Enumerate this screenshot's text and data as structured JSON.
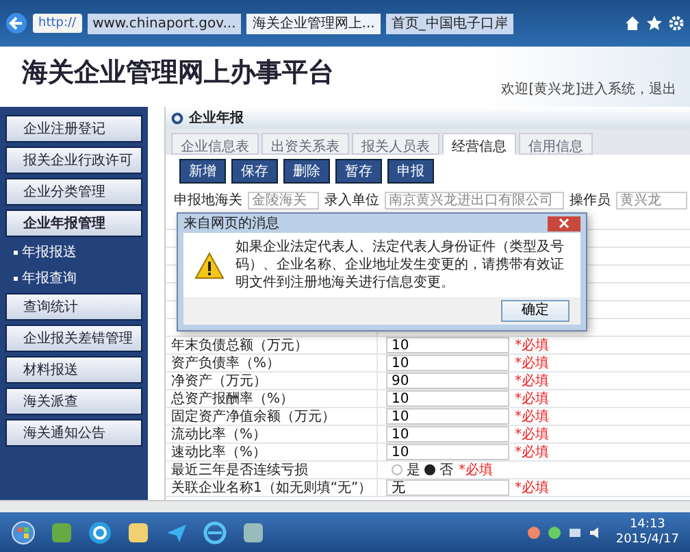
{
  "browser": {
    "address": "http://",
    "tabs": [
      {
        "label": "www.chinaport.gov...",
        "selected": false
      },
      {
        "label": "海关企业管理网上...",
        "selected": true
      },
      {
        "label": "首页_中国电子口岸",
        "selected": false
      }
    ]
  },
  "header": {
    "title": "海关企业管理网上办事平台",
    "welcome": "欢迎[黄兴龙]进入系统，退出"
  },
  "sidebar": {
    "items": [
      {
        "label": "企业注册登记",
        "expanded": false
      },
      {
        "label": "报关企业行政许可",
        "expanded": false
      },
      {
        "label": "企业分类管理",
        "expanded": false
      },
      {
        "label": "企业年报管理",
        "expanded": true,
        "children": [
          {
            "label": "年报报送"
          },
          {
            "label": "年报查询"
          }
        ]
      },
      {
        "label": "查询统计",
        "expanded": false
      },
      {
        "label": "企业报关差错管理",
        "expanded": false
      },
      {
        "label": "材料报送",
        "expanded": false
      },
      {
        "label": "海关派查",
        "expanded": false
      },
      {
        "label": "海关通知公告",
        "expanded": false
      }
    ]
  },
  "panel": {
    "title": "企业年报",
    "tabs": [
      {
        "label": "企业信息表",
        "selected": false
      },
      {
        "label": "出资关系表",
        "selected": false
      },
      {
        "label": "报关人员表",
        "selected": false
      },
      {
        "label": "经营信息",
        "selected": true
      },
      {
        "label": "信用信息",
        "selected": false
      }
    ],
    "buttons": [
      "新增",
      "保存",
      "删除",
      "暂存",
      "申报"
    ],
    "filters": [
      {
        "label": "申报地海关",
        "value": "金陵海关"
      },
      {
        "label": "录入单位",
        "value": "南京黄兴龙进出口有限公司"
      },
      {
        "label": "操作员",
        "value": "黄兴龙"
      }
    ],
    "rows": [
      {
        "kind": "input",
        "label": "年末负债总额（万元）",
        "value": "10",
        "required": "*必填"
      },
      {
        "kind": "input",
        "label": "资产负债率（%）",
        "value": "10",
        "required": "*必填"
      },
      {
        "kind": "input",
        "label": "净资产（万元）",
        "value": "90",
        "required": "*必填"
      },
      {
        "kind": "input",
        "label": "总资产报酬率（%）",
        "value": "10",
        "required": "*必填"
      },
      {
        "kind": "input",
        "label": "固定资产净值余额（万元）",
        "value": "10",
        "required": "*必填"
      },
      {
        "kind": "input",
        "label": "流动比率（%）",
        "value": "10",
        "required": "*必填"
      },
      {
        "kind": "input",
        "label": "速动比率（%）",
        "value": "10",
        "required": "*必填"
      },
      {
        "kind": "radio",
        "label": "最近三年是否连续亏损",
        "options": [
          {
            "label": "是",
            "selected": false
          },
          {
            "label": "否",
            "selected": true
          }
        ],
        "required": "*必填"
      },
      {
        "kind": "input",
        "label": "关联企业名称1（如无则填“无”）",
        "value": "无",
        "required": "*必填"
      }
    ]
  },
  "dialog": {
    "title": "来自网页的消息",
    "message": "如果企业法定代表人、法定代表人身份证件（类型及号码）、企业名称、企业地址发生变更的，请携带有效证明文件到注册地海关进行信息变更。",
    "button": "确定"
  },
  "taskbar": {
    "time": "14:13",
    "date": "2015/4/17"
  }
}
